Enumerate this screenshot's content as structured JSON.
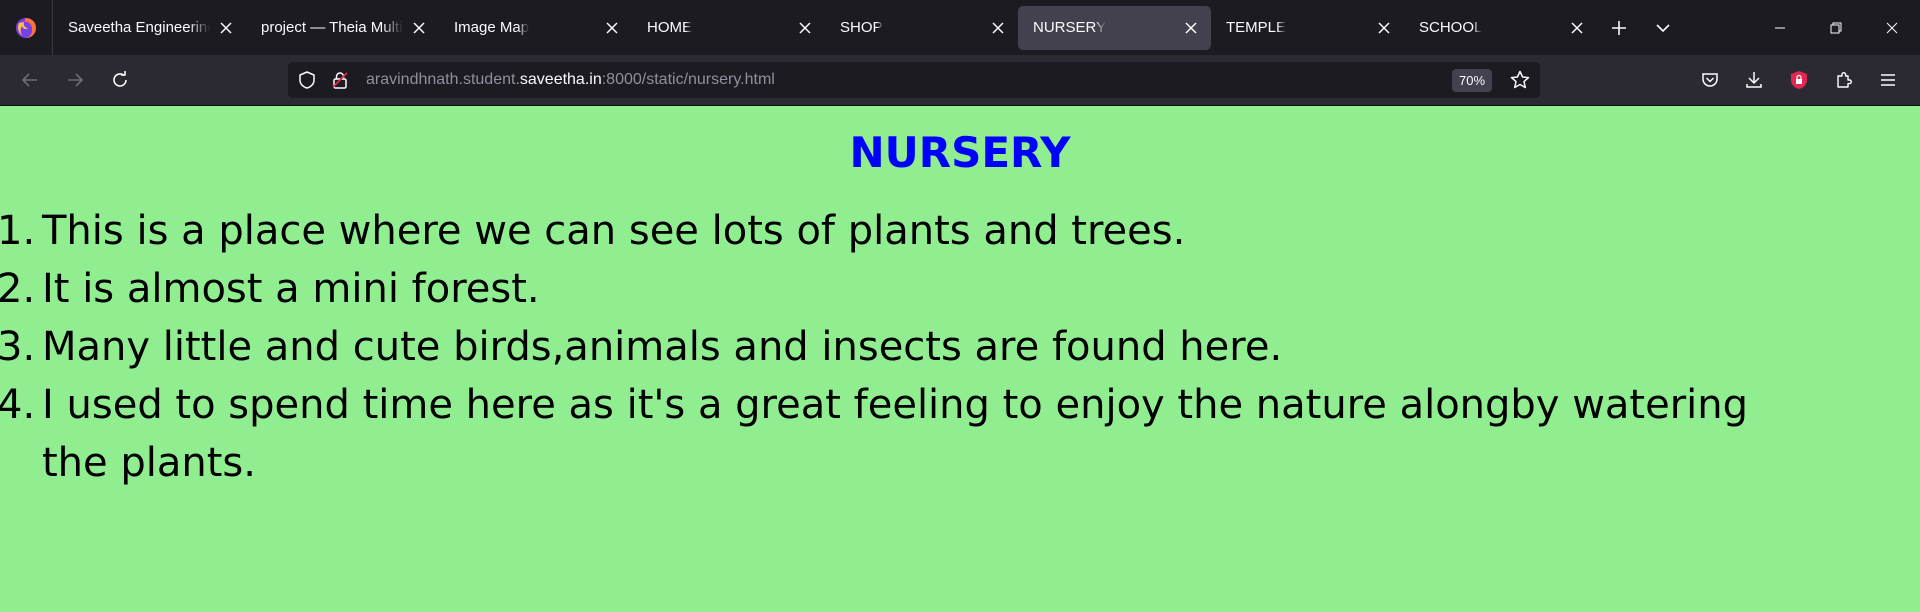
{
  "browser": {
    "tabs": [
      {
        "label": "Saveetha Engineering",
        "active": false
      },
      {
        "label": "project — Theia Multi-",
        "active": false
      },
      {
        "label": "Image Map",
        "active": false
      },
      {
        "label": "HOME",
        "active": false
      },
      {
        "label": "SHOP",
        "active": false
      },
      {
        "label": "NURSERY",
        "active": true
      },
      {
        "label": "TEMPLE",
        "active": false
      },
      {
        "label": "SCHOOL",
        "active": false
      }
    ],
    "url": {
      "prefix": "aravindhnath.student.",
      "host": "saveetha.in",
      "suffix": ":8000/static/nursery.html"
    },
    "zoom": "70%"
  },
  "page": {
    "title": "NURSERY",
    "items": [
      {
        "num": "1.",
        "text": "This is a place where we can see lots of plants and trees."
      },
      {
        "num": "2.",
        "text": "It is almost a mini forest."
      },
      {
        "num": "3.",
        "text": "Many little and cute birds,animals and insects are found here."
      },
      {
        "num": "4.",
        "text": "I used to spend time here as it's a great feeling to enjoy the nature alongby watering the plants."
      }
    ]
  },
  "colors": {
    "page_background": "#90ee90",
    "title": "#0000ff",
    "tabstrip": "#1c1b22",
    "navbar": "#2b2a33",
    "active_tab": "#42414d"
  }
}
